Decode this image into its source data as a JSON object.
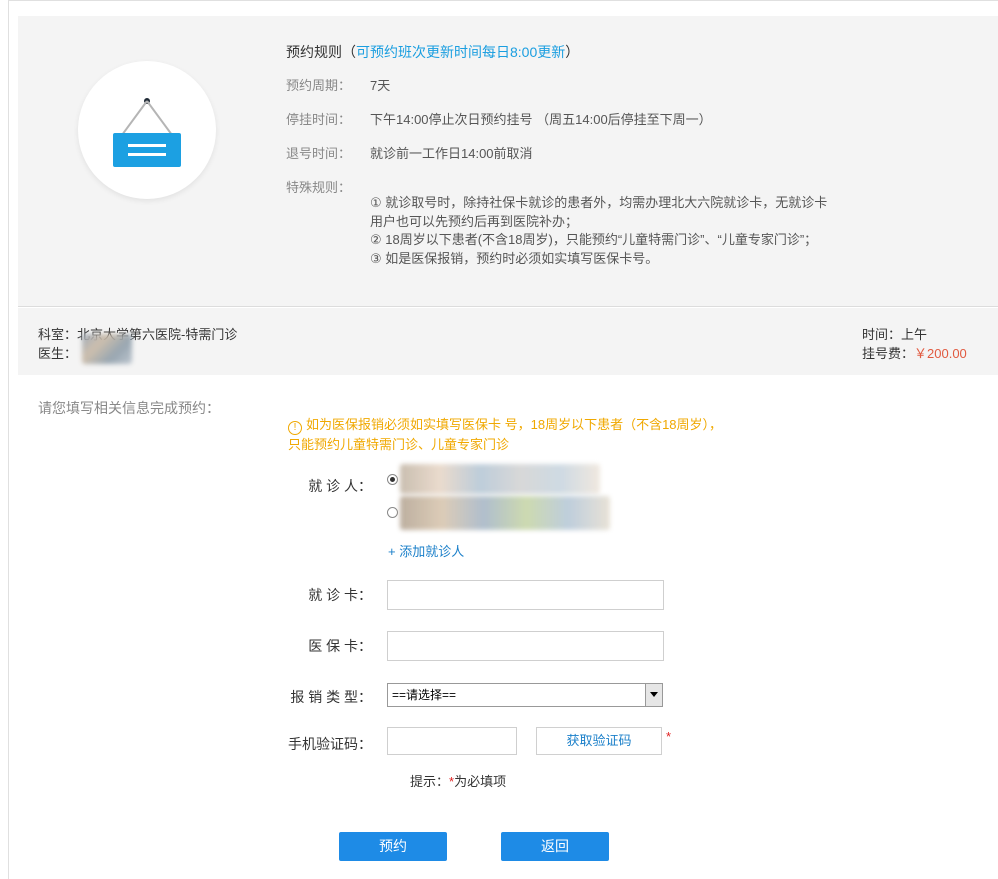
{
  "rules": {
    "title": "预约规则",
    "title_paren_open": "（",
    "title_accent": "可预约班次更新时间每日8:00更新",
    "title_paren_close": "）",
    "period_label": "预约周期：",
    "period_value": "7天",
    "stop_label": "停挂时间：",
    "stop_value": "下午14:00停止次日预约挂号 （周五14:00后停挂至下周一）",
    "refund_label": "退号时间：",
    "refund_value": "就诊前一工作日14:00前取消",
    "special_label": "特殊规则：",
    "special_items": [
      "① 就诊取号时，除持社保卡就诊的患者外，均需办理北大六院就诊卡，无就诊卡用户也可以先预约后再到医院补办；",
      "② 18周岁以下患者(不含18周岁)，只能预约“儿童特需门诊”、“儿童专家门诊”；",
      "③ 如是医保报销，预约时必须如实填写医保卡号。"
    ],
    "icon": "hanging-sign-icon",
    "accent_color": "#1a9ee0"
  },
  "info": {
    "dept_label": "科室：",
    "dept_value": "北京大学第六医院-特需门诊",
    "doctor_label": "医生：",
    "time_label": "时间：",
    "time_value": "上午",
    "fee_label": "挂号费：",
    "fee_value": "￥200.00",
    "price_color": "#e15a40"
  },
  "form": {
    "prompt": "请您填写相关信息完成预约：",
    "warning": "如为医保报销必须如实填写医保卡 号，18周岁以下患者（不含18周岁），只能预约儿童特需门诊、儿童专家门诊",
    "warning_icon": "exclamation-circle-icon",
    "patient_label": "就 诊 人：",
    "add_patient": "+ 添加就诊人",
    "card_label": "就 诊 卡：",
    "card_value": "",
    "insurance_label": "医 保 卡：",
    "insurance_value": "",
    "reimburse_label": "报 销 类 型：",
    "reimburse_selected": "==请选择==",
    "sms_label": "手机验证码：",
    "sms_value": "",
    "get_code_button": "获取验证码",
    "required_star": "*",
    "hint_prefix": "提示：",
    "hint_star": "*",
    "hint_suffix": "为必填项",
    "submit_button": "预约",
    "back_button": "返回",
    "button_color": "#1e8be6"
  }
}
